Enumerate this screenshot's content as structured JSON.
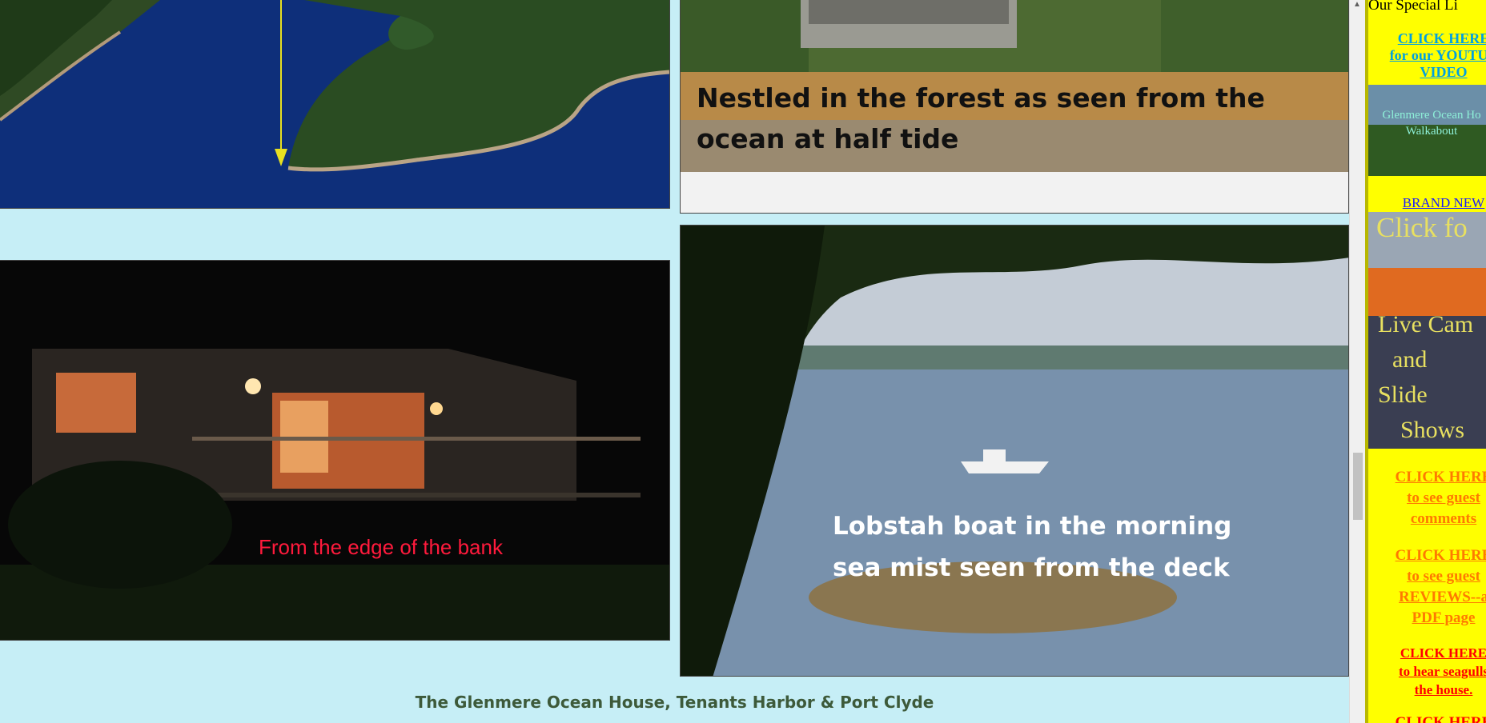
{
  "captions": {
    "forest": "Nestled in the forest as seen from the\nocean at half tide",
    "bank": "From the edge of the bank",
    "lobster": "Lobstah boat in the morning\nsea mist seen from the deck"
  },
  "footer": "The Glenmere Ocean House, Tenants Harbor & Port Clyde",
  "sidebar": {
    "heading": "Our Special Li",
    "youtube_link": "CLICK HERE\nfor our YOUTUB\nVIDEO",
    "video_thumb_text": "Glenmere Ocean Ho\nWalkabout",
    "brand_new": "BRAND NEW",
    "cam_thumb_text": [
      "Click fo",
      "Live Cam",
      "and",
      "Slide",
      "Shows"
    ],
    "guest_comments": "CLICK HERE\nto see guest\ncomments",
    "reviews": "CLICK HERE\nto see guest\nREVIEWS--a\nPDF page",
    "seagulls": "CLICK HERE\nto hear seagulls\nthe house.",
    "more": "CLICK HERE"
  },
  "colors": {
    "page_bg": "#c6eef6",
    "sidebar_bg": "#ffff00",
    "link_blue": "#00a0e0",
    "link_orange": "#ff7a00",
    "link_red": "#ff0000",
    "caption_red": "#ff1a3c"
  }
}
